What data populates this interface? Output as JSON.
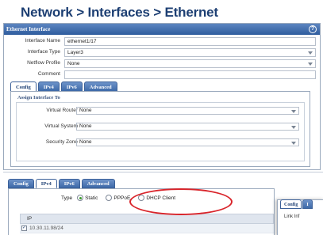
{
  "page": {
    "title": "Network > Interfaces > Ethernet"
  },
  "dialog": {
    "title": "Ethernet Interface",
    "help_glyph": "?",
    "fields": [
      {
        "label": "Interface Name",
        "value": "ethernet1/17",
        "type": "text"
      },
      {
        "label": "Interface Type",
        "value": "Layer3",
        "type": "select"
      },
      {
        "label": "Netflow Profile",
        "value": "None",
        "type": "select"
      },
      {
        "label": "Comment",
        "value": "",
        "type": "text"
      }
    ],
    "tabs": [
      "Config",
      "IPv4",
      "IPv6",
      "Advanced"
    ],
    "active_tab": "Config",
    "assign_section": {
      "title": "Assign Interface To",
      "fields": [
        {
          "label": "Virtual Router",
          "value": "None"
        },
        {
          "label": "Virtual System",
          "value": "None"
        },
        {
          "label": "Security Zone",
          "value": "None"
        }
      ]
    }
  },
  "zoom": {
    "tabs": [
      "Config",
      "IPv4",
      "IPv6",
      "Advanced"
    ],
    "active_tab": "IPv4",
    "type_label": "Type",
    "type_options": [
      {
        "label": "Static",
        "checked": true
      },
      {
        "label": "PPPoE",
        "checked": false
      },
      {
        "label": "DHCP Client",
        "checked": false
      }
    ],
    "table": {
      "header": "IP",
      "rows": [
        {
          "value": "10.30.11.98/24",
          "checked": true
        }
      ]
    },
    "side_panel": {
      "tabs": [
        "Config",
        "I"
      ],
      "label": "Link Inf"
    }
  },
  "colors": {
    "title": "#1d3f73",
    "header_blue": "#2f5d9e",
    "highlight": "#d9252b",
    "radio_checked": "#3a9a2a"
  }
}
